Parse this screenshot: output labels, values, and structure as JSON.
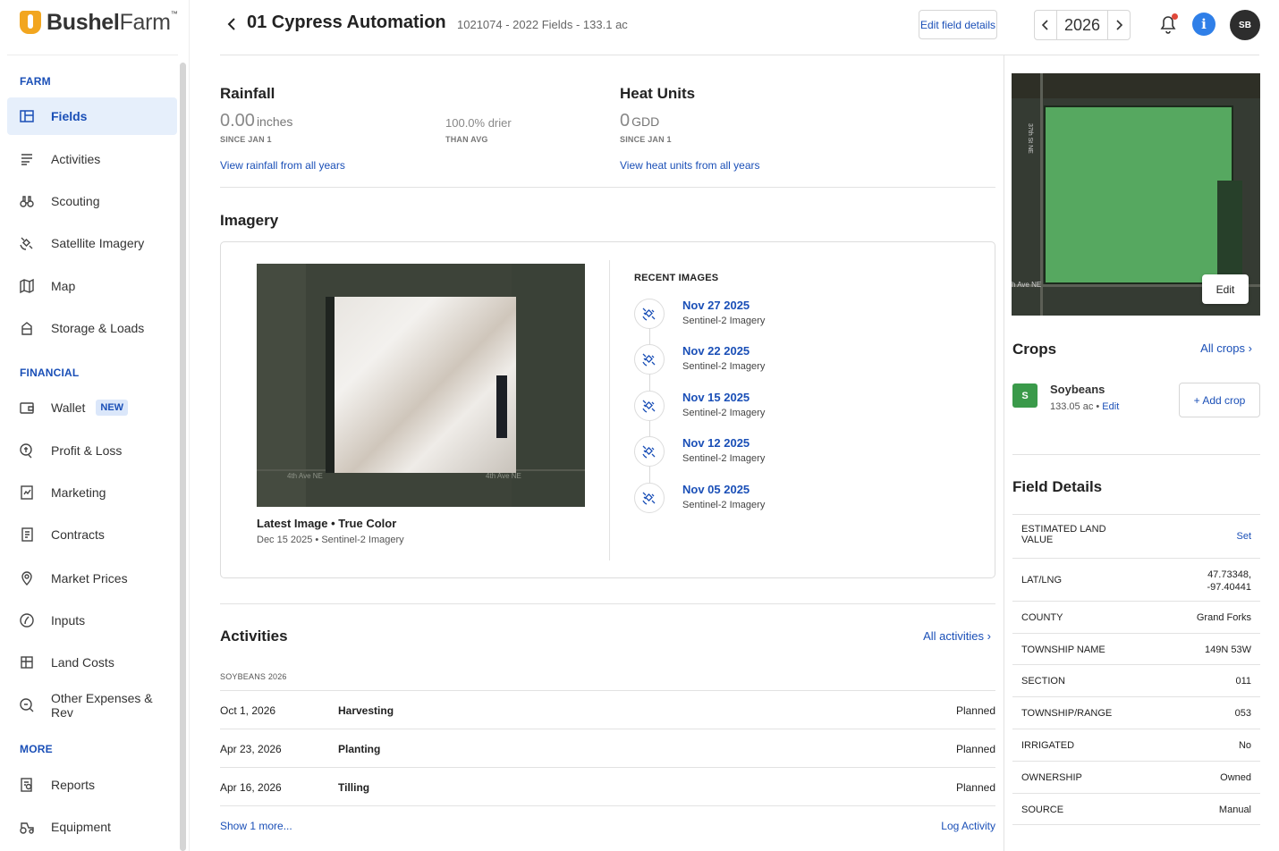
{
  "brand": {
    "bold": "Bushel",
    "light": "Farm",
    "tm": "™"
  },
  "colors": {
    "accent": "#1a4fb7",
    "active_bg": "#e6effb",
    "crop_green": "#3a9a4a",
    "alert_red": "#e0483a",
    "info_blue": "#2f7fe8"
  },
  "sidebar": {
    "sections": {
      "farm": "FARM",
      "financial": "FINANCIAL",
      "more": "MORE"
    },
    "items": [
      {
        "label": "Fields",
        "icon": "fields-icon"
      },
      {
        "label": "Activities",
        "icon": "activities-icon"
      },
      {
        "label": "Scouting",
        "icon": "binoculars-icon"
      },
      {
        "label": "Satellite Imagery",
        "icon": "satellite-icon"
      },
      {
        "label": "Map",
        "icon": "map-icon"
      },
      {
        "label": "Storage & Loads",
        "icon": "storage-icon"
      },
      {
        "label": "Wallet",
        "icon": "wallet-icon",
        "badge": "NEW"
      },
      {
        "label": "Profit & Loss",
        "icon": "profit-loss-icon"
      },
      {
        "label": "Marketing",
        "icon": "marketing-icon"
      },
      {
        "label": "Contracts",
        "icon": "contracts-icon"
      },
      {
        "label": "Market Prices",
        "icon": "market-prices-icon"
      },
      {
        "label": "Inputs",
        "icon": "inputs-icon"
      },
      {
        "label": "Land Costs",
        "icon": "land-costs-icon"
      },
      {
        "label": "Other Expenses & Rev",
        "icon": "other-expenses-icon"
      },
      {
        "label": "Reports",
        "icon": "reports-icon"
      },
      {
        "label": "Equipment",
        "icon": "equipment-icon"
      }
    ]
  },
  "header": {
    "title": "01 Cypress Automation",
    "subtitle": "1021074 - 2022 Fields - 133.1 ac",
    "edit_button": "Edit field details",
    "year": "2026",
    "avatar_initials": "SB",
    "info_glyph": "i"
  },
  "rainfall": {
    "title": "Rainfall",
    "value": "0.00",
    "unit": "inches",
    "since": "SINCE JAN 1",
    "compare_value": "100.0% drier",
    "compare_caption": "THAN AVG",
    "link": "View rainfall from all years"
  },
  "heat_units": {
    "title": "Heat Units",
    "value": "0",
    "unit": "GDD",
    "since": "SINCE JAN 1",
    "link": "View heat units from all years"
  },
  "imagery": {
    "title": "Imagery",
    "road_label_left": "4th Ave NE",
    "road_label_right": "4th Ave NE",
    "latest_title": "Latest Image • True Color",
    "latest_sub": "Dec 15 2025 • Sentinel-2 Imagery",
    "recent_label": "RECENT IMAGES",
    "recent": [
      {
        "date": "Nov 27 2025",
        "source": "Sentinel-2 Imagery"
      },
      {
        "date": "Nov 22 2025",
        "source": "Sentinel-2 Imagery"
      },
      {
        "date": "Nov 15 2025",
        "source": "Sentinel-2 Imagery"
      },
      {
        "date": "Nov 12 2025",
        "source": "Sentinel-2 Imagery"
      },
      {
        "date": "Nov 05 2025",
        "source": "Sentinel-2 Imagery"
      }
    ]
  },
  "activities": {
    "title": "Activities",
    "all_link": "All activities",
    "group_label": "SOYBEANS 2026",
    "rows": [
      {
        "date": "Oct 1, 2026",
        "name": "Harvesting",
        "status": "Planned"
      },
      {
        "date": "Apr 23, 2026",
        "name": "Planting",
        "status": "Planned"
      },
      {
        "date": "Apr 16, 2026",
        "name": "Tilling",
        "status": "Planned"
      }
    ],
    "show_more": "Show 1 more...",
    "log_link": "Log Activity"
  },
  "map": {
    "road_label_v": "37th St NE",
    "road_label_h": "h Ave NE",
    "edit": "Edit"
  },
  "crops": {
    "title": "Crops",
    "all_link": "All crops",
    "item": {
      "badge": "S",
      "name": "Soybeans",
      "acres": "133.05 ac",
      "sep": " • ",
      "edit": "Edit"
    },
    "add_button": "+ Add crop"
  },
  "field_details": {
    "title": "Field Details",
    "rows": [
      {
        "key": "ESTIMATED LAND VALUE",
        "value": "Set"
      },
      {
        "key": "LAT/LNG",
        "value": "47.73348,\n-97.40441"
      },
      {
        "key": "COUNTY",
        "value": "Grand Forks"
      },
      {
        "key": "TOWNSHIP NAME",
        "value": "149N 53W"
      },
      {
        "key": "SECTION",
        "value": "011"
      },
      {
        "key": "TOWNSHIP/RANGE",
        "value": "053"
      },
      {
        "key": "IRRIGATED",
        "value": "No"
      },
      {
        "key": "OWNERSHIP",
        "value": "Owned"
      },
      {
        "key": "SOURCE",
        "value": "Manual"
      }
    ]
  }
}
